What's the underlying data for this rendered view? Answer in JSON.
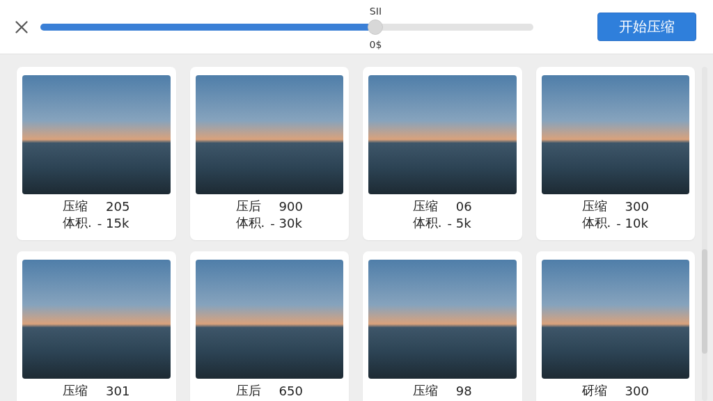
{
  "toolbar": {
    "slider": {
      "label_above": "SII",
      "label_below": "0$",
      "level": 0.68
    },
    "start_button": "开始压缩"
  },
  "cards": [
    {
      "lines": [
        {
          "label": "压缩",
          "value": "205"
        },
        {
          "label": "体积.",
          "value": "- 15k"
        }
      ]
    },
    {
      "lines": [
        {
          "label": "压后",
          "value": "900"
        },
        {
          "label": "体积.",
          "value": "- 30k"
        }
      ]
    },
    {
      "lines": [
        {
          "label": "压缩",
          "value": "06"
        },
        {
          "label": "体积.",
          "value": "- 5k"
        }
      ]
    },
    {
      "lines": [
        {
          "label": "压缩",
          "value": "300"
        },
        {
          "label": "体积.",
          "value": "- 10k"
        }
      ]
    },
    {
      "lines": [
        {
          "label": "压缩",
          "value": "301"
        }
      ]
    },
    {
      "lines": [
        {
          "label": "压后",
          "value": "650"
        }
      ]
    },
    {
      "lines": [
        {
          "label": "压缩",
          "value": "98"
        }
      ]
    },
    {
      "lines": [
        {
          "label": "砑缩",
          "value": "300"
        }
      ]
    }
  ]
}
